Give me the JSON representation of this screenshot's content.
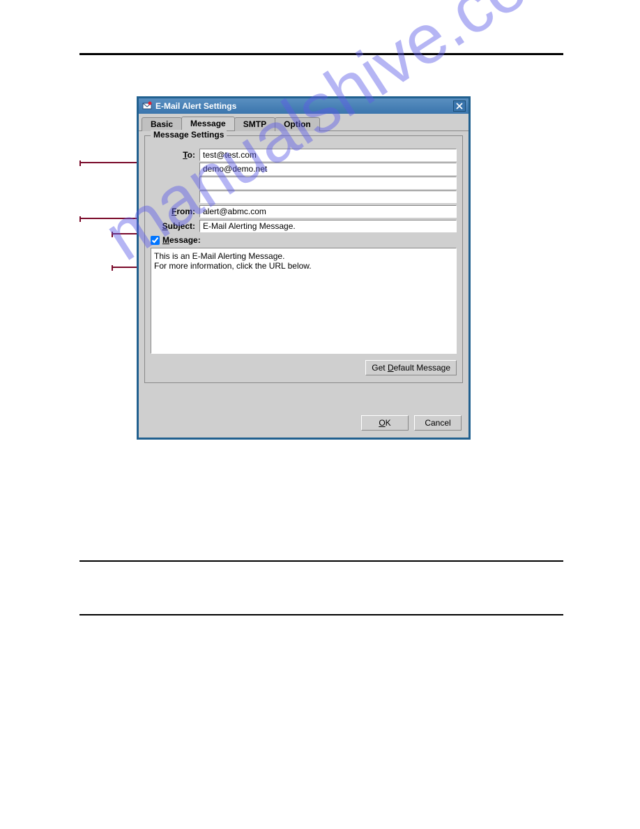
{
  "window": {
    "title": "E-Mail Alert Settings"
  },
  "tabs": [
    {
      "label": "Basic"
    },
    {
      "label": "Message"
    },
    {
      "label": "SMTP"
    },
    {
      "label": "Option"
    }
  ],
  "group": {
    "legend": "Message Settings"
  },
  "labels": {
    "to": "To:",
    "from": "From:",
    "subject": "Subject:",
    "message": "Message:"
  },
  "fields": {
    "to": [
      "test@test.com",
      "demo@demo.net",
      "",
      ""
    ],
    "from": "alert@abmc.com",
    "subject": "E-Mail Alerting Message.",
    "message_checked": true,
    "message": "This is an E-Mail Alerting Message.\nFor more information, click the URL below."
  },
  "buttons": {
    "get_default": "Get Default Message",
    "ok": "OK",
    "cancel": "Cancel"
  },
  "watermark": "manualshive.com"
}
